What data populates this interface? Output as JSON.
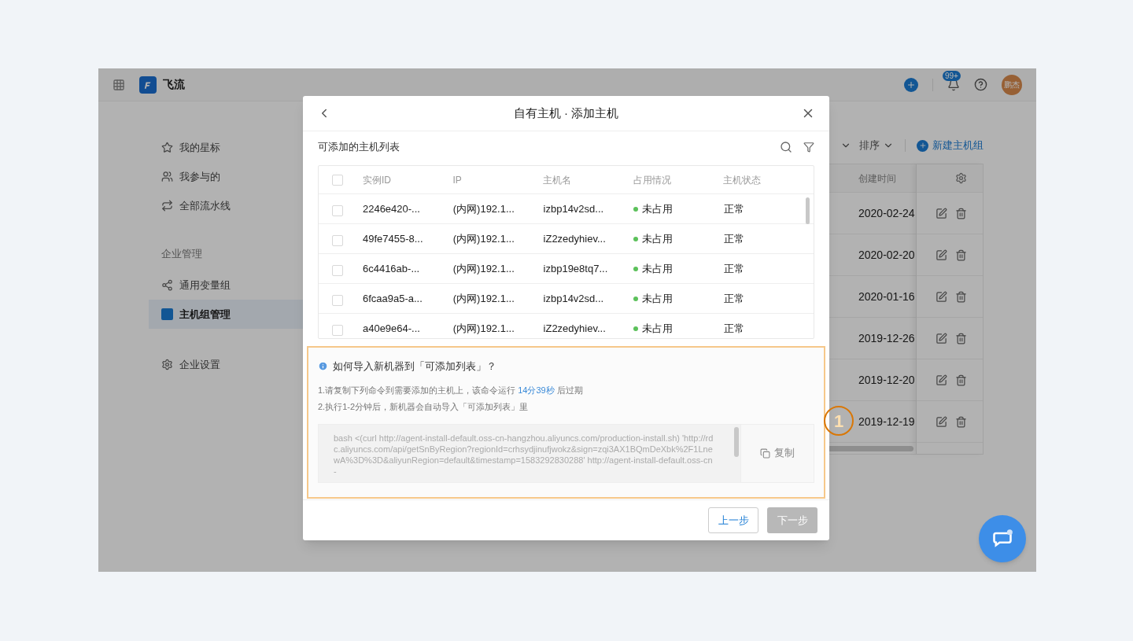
{
  "app": {
    "name": "飞流",
    "notifications_badge": "99+",
    "avatar": "鹏杰"
  },
  "sidebar": {
    "items": [
      {
        "kind": "link",
        "label": "我的星标",
        "selected": false
      },
      {
        "kind": "link",
        "label": "我参与的",
        "selected": false
      },
      {
        "kind": "link",
        "label": "全部流水线",
        "selected": false
      },
      {
        "kind": "heading",
        "label": "企业管理"
      },
      {
        "kind": "link",
        "label": "通用变量组",
        "selected": false
      },
      {
        "kind": "link",
        "label": "主机组管理",
        "selected": true
      },
      {
        "kind": "link",
        "label": "企业设置",
        "selected": false
      }
    ]
  },
  "toolbar": {
    "sort_label": "排序",
    "new_button": "新建主机组"
  },
  "background_table": {
    "columns": [
      "创建时间"
    ],
    "rows": [
      {
        "created": "2020-02-24"
      },
      {
        "created": "2020-02-20"
      },
      {
        "created": "2020-01-16"
      },
      {
        "created": "2019-12-26"
      },
      {
        "created": "2019-12-20"
      },
      {
        "created": "2019-12-19"
      }
    ]
  },
  "modal": {
    "title": "自有主机 · 添加主机",
    "list_title": "可添加的主机列表",
    "table": {
      "all_checked": false,
      "columns": [
        "实例ID",
        "IP",
        "主机名",
        "占用情况",
        "主机状态"
      ],
      "rows": [
        {
          "checked": false,
          "instance_id": "2246e420-...",
          "ip": "(内网)192.1...",
          "hostname": "izbp14v2sd...",
          "occupancy": "未占用",
          "status": "正常"
        },
        {
          "checked": false,
          "instance_id": "49fe7455-8...",
          "ip": "(内网)192.1...",
          "hostname": "iZ2zedyhiev...",
          "occupancy": "未占用",
          "status": "正常"
        },
        {
          "checked": false,
          "instance_id": "6c4416ab-...",
          "ip": "(内网)192.1...",
          "hostname": "izbp19e8tq7...",
          "occupancy": "未占用",
          "status": "正常"
        },
        {
          "checked": false,
          "instance_id": "6fcaa9a5-a...",
          "ip": "(内网)192.1...",
          "hostname": "izbp14v2sd...",
          "occupancy": "未占用",
          "status": "正常"
        },
        {
          "checked": false,
          "instance_id": "a40e9e64-...",
          "ip": "(内网)192.1...",
          "hostname": "iZ2zedyhiev...",
          "occupancy": "未占用",
          "status": "正常"
        }
      ]
    },
    "help": {
      "title": "如何导入新机器到「可添加列表」？",
      "step1_before": "1.请复制下列命令到需要添加的主机上，该命令运行 ",
      "countdown": "14分39秒",
      "step1_after": " 后过期",
      "step2": "2.执行1-2分钟后，新机器会自动导入「可添加列表」里",
      "command": "bash <(curl http://agent-install-default.oss-cn-hangzhou.aliyuncs.com/production-install.sh) 'http://rdc.aliyuncs.com/api/getSnByRegion?regionId=crhsydjinufjwokz&sign=zqi3AX1BQmDeXbk%2F1LnewA%3D%3D&aliyunRegion=default&timestamp=1583292830288' http://agent-install-default.oss-cn-",
      "copy_button": "复制"
    },
    "buttons": [
      {
        "label": "上一步",
        "disabled": false
      },
      {
        "label": "下一步",
        "disabled": true
      }
    ]
  },
  "annotation": {
    "label": "1"
  }
}
